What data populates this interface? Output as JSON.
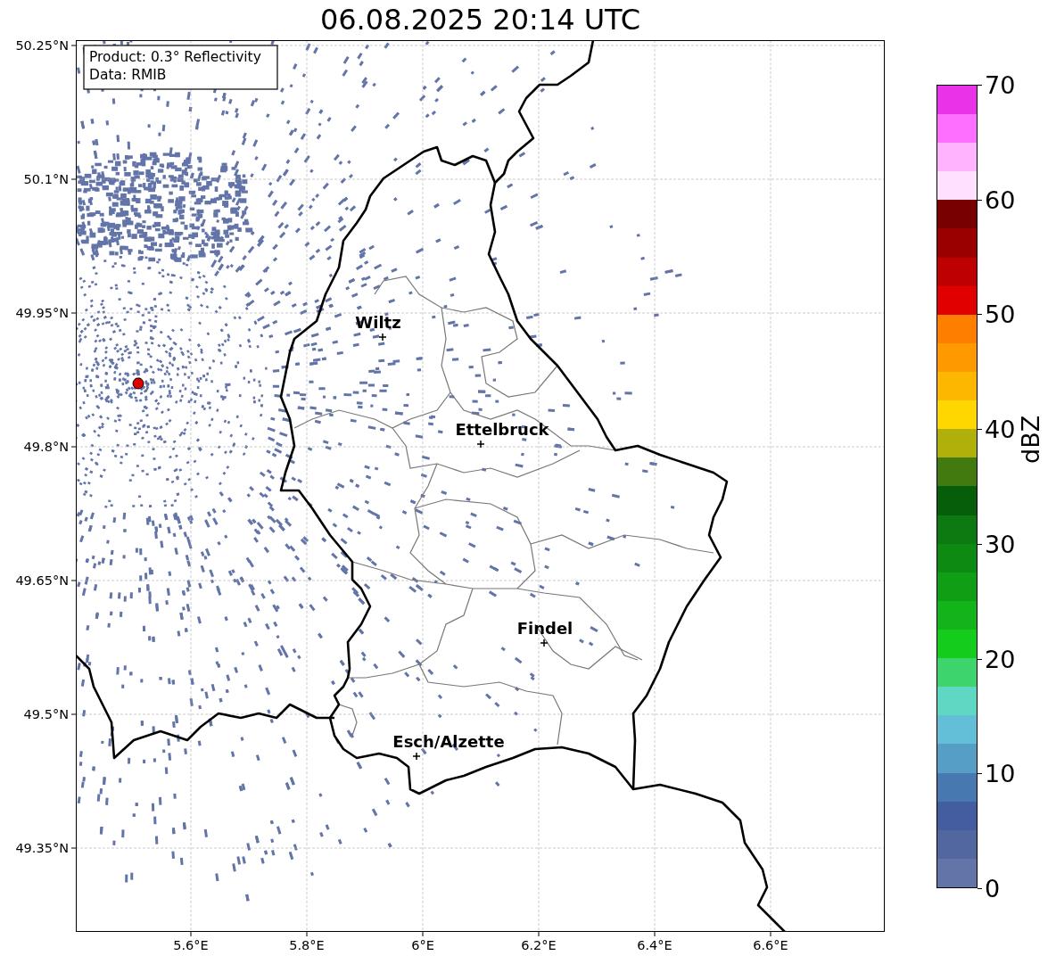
{
  "title": "06.08.2025 20:14 UTC",
  "info_box": {
    "lines": [
      "Product: 0.3° Reflectivity",
      "Data: RMIB"
    ]
  },
  "map": {
    "y_tick_labels": [
      "50.25°N",
      "50.1°N",
      "49.95°N",
      "49.8°N",
      "49.65°N",
      "49.5°N",
      "49.35°N"
    ],
    "x_tick_labels": [
      "5.6°E",
      "5.8°E",
      "6°E",
      "6.2°E",
      "6.4°E",
      "6.6°E"
    ],
    "cities": [
      {
        "name": "Wiltz"
      },
      {
        "name": "Ettelbruck"
      },
      {
        "name": "Findel"
      },
      {
        "name": "Esch/Alzette"
      }
    ]
  },
  "colorbar": {
    "label": "dBZ",
    "tick_labels": [
      "70",
      "60",
      "50",
      "40",
      "30",
      "20",
      "10",
      "0"
    ],
    "segments": [
      {
        "color": "#6374a8"
      },
      {
        "color": "#52669f"
      },
      {
        "color": "#435da0"
      },
      {
        "color": "#4878b0"
      },
      {
        "color": "#579ec6"
      },
      {
        "color": "#63bfd8"
      },
      {
        "color": "#5fd8c3"
      },
      {
        "color": "#3dd46e"
      },
      {
        "color": "#14cc1c"
      },
      {
        "color": "#12b41a"
      },
      {
        "color": "#0f9e14"
      },
      {
        "color": "#0d8a12"
      },
      {
        "color": "#0c7a10"
      },
      {
        "color": "#075e0a"
      },
      {
        "color": "#437a0f"
      },
      {
        "color": "#b0b00a"
      },
      {
        "color": "#fed700"
      },
      {
        "color": "#feb700"
      },
      {
        "color": "#fe9900"
      },
      {
        "color": "#fe7f00"
      },
      {
        "color": "#e00000"
      },
      {
        "color": "#bf0000"
      },
      {
        "color": "#9a0000"
      },
      {
        "color": "#780000"
      },
      {
        "color": "#ffe0ff"
      },
      {
        "color": "#ffb3ff"
      },
      {
        "color": "#ff6fff"
      },
      {
        "color": "#e933e9"
      }
    ]
  }
}
